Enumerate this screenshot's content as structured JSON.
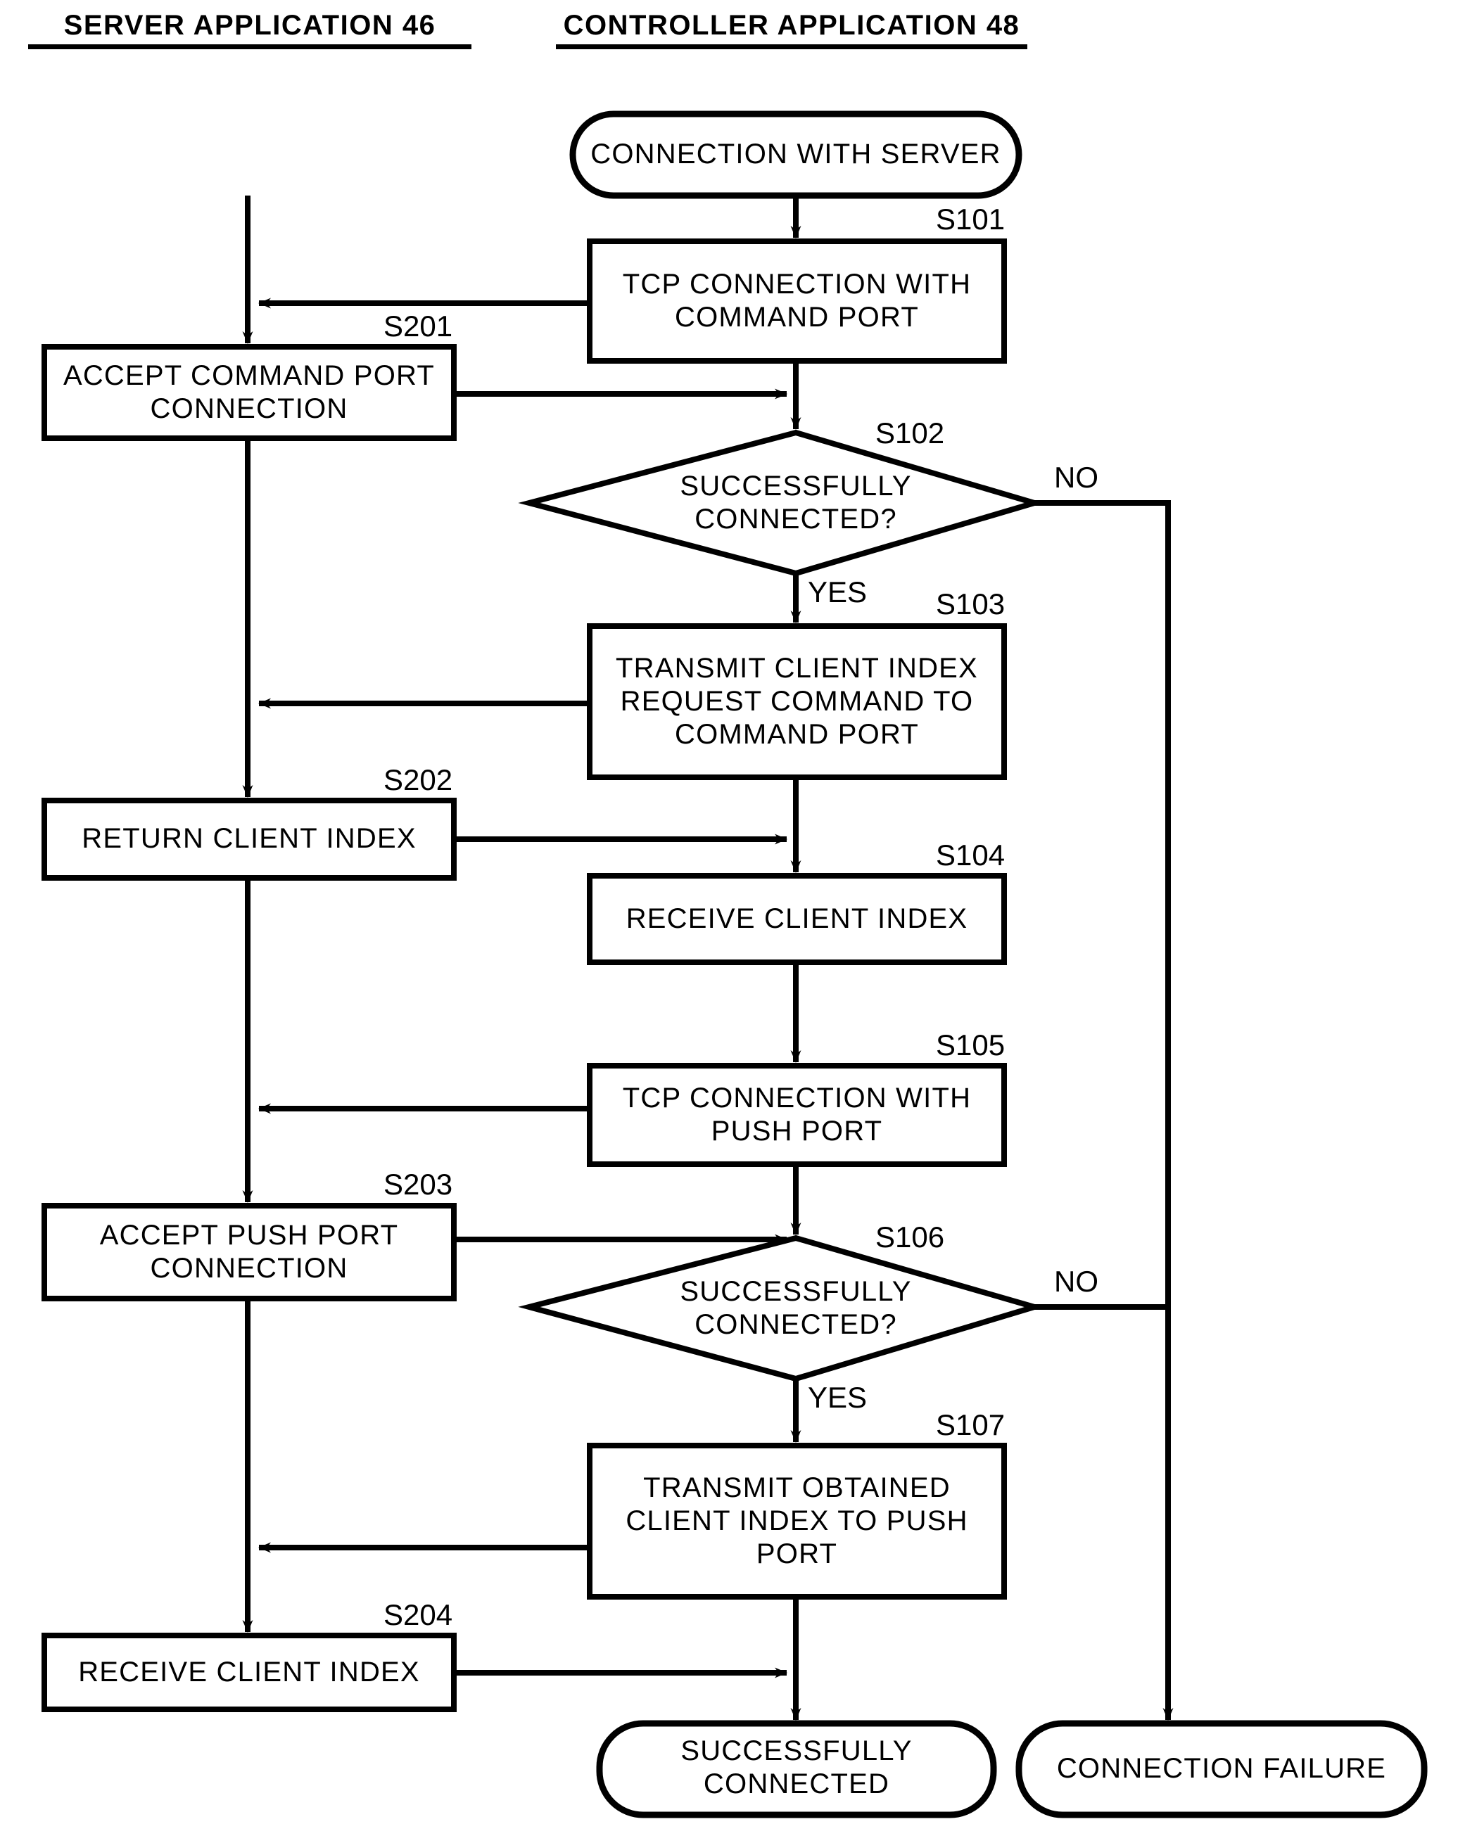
{
  "figure": {
    "type": "flowchart",
    "columns": [
      {
        "id": "server",
        "title": "SERVER APPLICATION 46"
      },
      {
        "id": "controller",
        "title": "CONTROLLER APPLICATION 48"
      }
    ],
    "nodes": {
      "start": {
        "label": "CONNECTION WITH SERVER",
        "shape": "terminator",
        "column": "controller"
      },
      "s101": {
        "id": "S101",
        "label": "TCP CONNECTION WITH\nCOMMAND PORT",
        "shape": "process",
        "column": "controller"
      },
      "s102": {
        "id": "S102",
        "label": "SUCCESSFULLY\nCONNECTED?",
        "shape": "decision",
        "column": "controller"
      },
      "s103": {
        "id": "S103",
        "label": "TRANSMIT CLIENT INDEX\nREQUEST COMMAND TO\nCOMMAND PORT",
        "shape": "process",
        "column": "controller"
      },
      "s104": {
        "id": "S104",
        "label": "RECEIVE CLIENT INDEX",
        "shape": "process",
        "column": "controller"
      },
      "s105": {
        "id": "S105",
        "label": "TCP CONNECTION WITH\nPUSH PORT",
        "shape": "process",
        "column": "controller"
      },
      "s106": {
        "id": "S106",
        "label": "SUCCESSFULLY\nCONNECTED?",
        "shape": "decision",
        "column": "controller"
      },
      "s107": {
        "id": "S107",
        "label": "TRANSMIT OBTAINED\nCLIENT INDEX TO PUSH\nPORT",
        "shape": "process",
        "column": "controller"
      },
      "s201": {
        "id": "S201",
        "label": "ACCEPT COMMAND PORT\nCONNECTION",
        "shape": "process",
        "column": "server"
      },
      "s202": {
        "id": "S202",
        "label": "RETURN CLIENT INDEX",
        "shape": "process",
        "column": "server"
      },
      "s203": {
        "id": "S203",
        "label": "ACCEPT PUSH PORT\nCONNECTION",
        "shape": "process",
        "column": "server"
      },
      "s204": {
        "id": "S204",
        "label": "RECEIVE CLIENT INDEX",
        "shape": "process",
        "column": "server"
      },
      "end_success": {
        "label": "SUCCESSFULLY\nCONNECTED",
        "shape": "terminator",
        "column": "controller"
      },
      "end_failure": {
        "label": "CONNECTION FAILURE",
        "shape": "terminator",
        "column": "controller"
      }
    },
    "branch_labels": {
      "s102_no": "NO",
      "s102_yes": "YES",
      "s106_no": "NO",
      "s106_yes": "YES"
    },
    "colors": {
      "line": "#000000",
      "fill": "#ffffff",
      "text": "#000000"
    }
  }
}
